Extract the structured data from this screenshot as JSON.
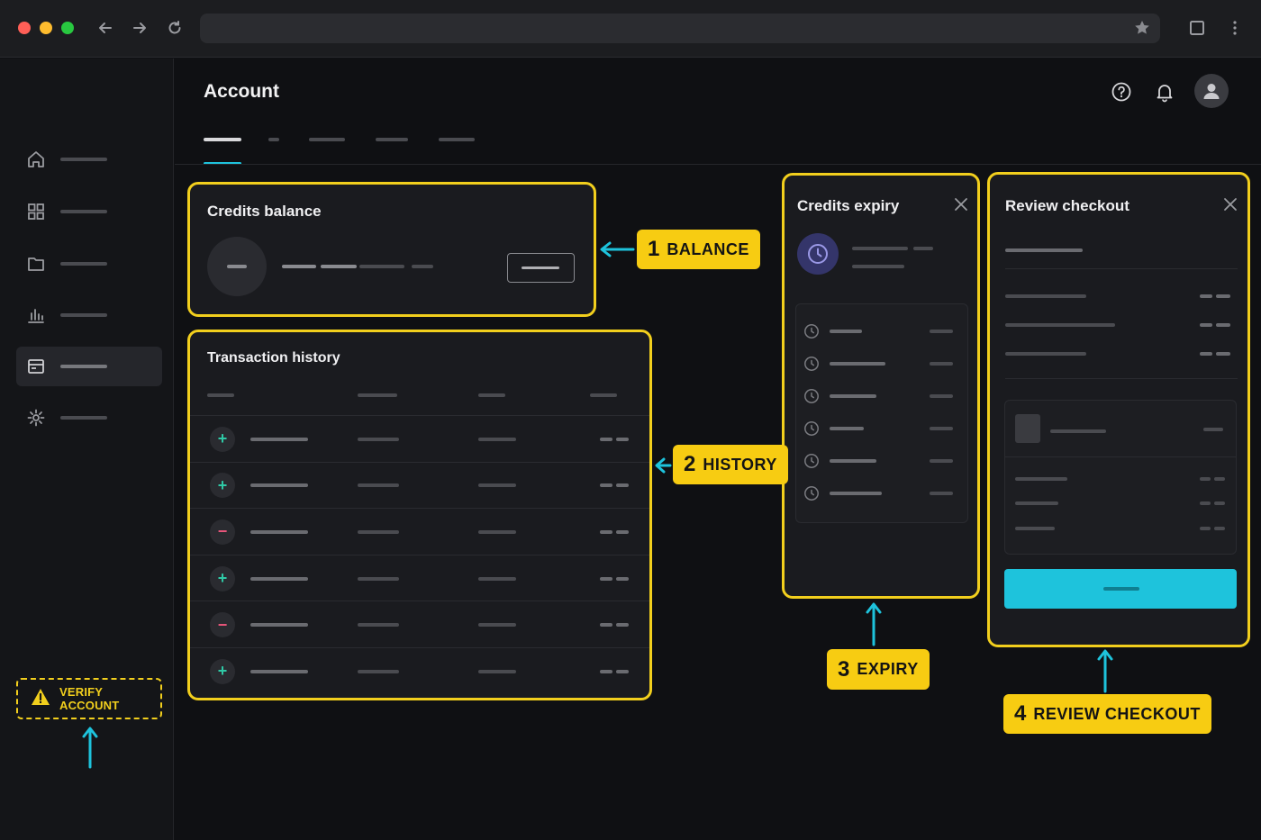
{
  "window": {
    "title": ""
  },
  "header": {
    "title": "Account"
  },
  "tabs": [
    "",
    "",
    "",
    "",
    ""
  ],
  "sidebar": {
    "items": [
      {
        "icon": "home-icon"
      },
      {
        "icon": "grid-icon"
      },
      {
        "icon": "folder-icon"
      },
      {
        "icon": "bar-chart-icon"
      },
      {
        "icon": "billing-icon",
        "active": true
      },
      {
        "icon": "gear-icon"
      }
    ],
    "verify_label": "VERIFY ACCOUNT"
  },
  "balance": {
    "title": "Credits balance"
  },
  "history": {
    "title": "Transaction history",
    "rows": [
      {
        "type": "plus",
        "symbol": "+"
      },
      {
        "type": "plus",
        "symbol": "+"
      },
      {
        "type": "minus",
        "symbol": "−"
      },
      {
        "type": "plus",
        "symbol": "+"
      },
      {
        "type": "minus",
        "symbol": "−"
      },
      {
        "type": "plus",
        "symbol": "+"
      }
    ]
  },
  "expiry": {
    "title": "Credits expiry"
  },
  "checkout": {
    "title": "Review checkout"
  },
  "callouts": [
    {
      "num": "1",
      "label": "BALANCE"
    },
    {
      "num": "2",
      "label": "HISTORY"
    },
    {
      "num": "3",
      "label": "EXPIRY"
    },
    {
      "num": "4",
      "label": "REVIEW CHECKOUT"
    }
  ],
  "colors": {
    "accent": "#1ec3dc",
    "highlight": "#f2cf1d",
    "callout": "#f7cc12",
    "plus": "#2fc9a6",
    "minus": "#e8557a",
    "expiry_icon": "#6b67c9"
  }
}
